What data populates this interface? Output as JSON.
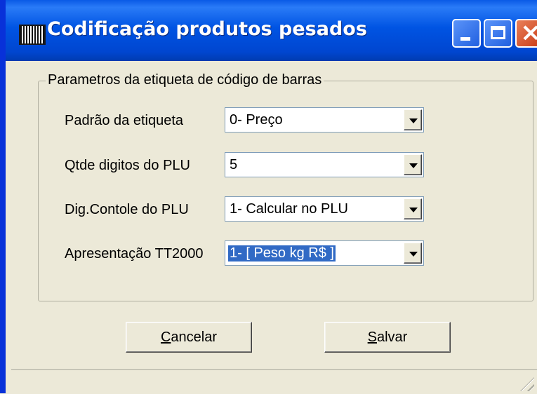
{
  "window": {
    "title": "Codificação produtos pesados",
    "controls": [
      "minimize",
      "maximize",
      "close"
    ]
  },
  "group": {
    "legend": "Parametros da etiqueta de código de barras",
    "rows": [
      {
        "label": "Padrão da etiqueta",
        "value": "0- Preço",
        "selected": false
      },
      {
        "label": "Qtde digitos do PLU",
        "value": "5",
        "selected": false
      },
      {
        "label": "Dig.Contole do PLU",
        "value": "1- Calcular no PLU",
        "selected": false
      },
      {
        "label": "Apresentação TT2000",
        "value": "1- [ Peso kg   R$ ]",
        "selected": true
      }
    ]
  },
  "buttons": {
    "cancel": {
      "mnemonic": "C",
      "rest": "ancelar"
    },
    "save": {
      "mnemonic": "S",
      "rest": "alvar"
    }
  },
  "icons": {
    "app": "barcode-icon",
    "minimize": "minimize-icon",
    "maximize": "maximize-icon",
    "close": "close-icon",
    "dropdown": "chevron-down-icon",
    "grip": "resize-grip-icon"
  },
  "colors": {
    "titlebar": "#0054e3",
    "selection": "#316ac5",
    "face": "#ece9d8"
  }
}
